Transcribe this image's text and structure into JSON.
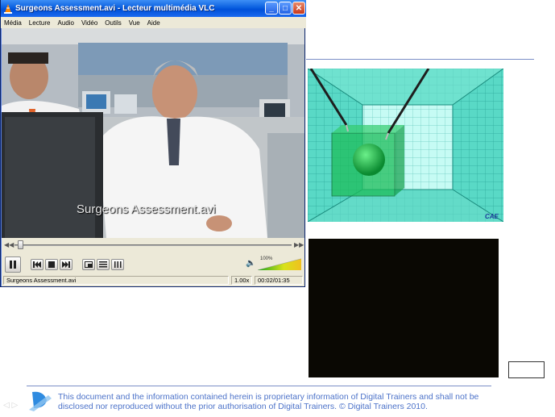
{
  "vlc": {
    "title": "Surgeons Assessment.avi - Lecteur multimédia VLC",
    "window_buttons": {
      "minimize": "_",
      "maximize": "□",
      "close": "✕"
    },
    "menu": [
      "Média",
      "Lecture",
      "Audio",
      "Vidéo",
      "Outils",
      "Vue",
      "Aide"
    ],
    "video_caption": "Surgeons Assessment.avi",
    "volume_percent": "100%",
    "volume_level": 1.0,
    "playback_progress": 0.02,
    "status": {
      "filename": "Surgeons Assessment.avi",
      "speed": "1.00x",
      "time": "00:02/01:35"
    },
    "icons": [
      "vlc-cone-icon",
      "skip-back-icon",
      "skip-forward-icon",
      "pause-icon",
      "previous-icon",
      "stop-icon",
      "next-icon",
      "fullscreen-icon",
      "playlist-icon",
      "equalizer-icon",
      "speaker-icon"
    ]
  },
  "sim": {
    "logo": "CAE",
    "colors": {
      "grid": "#49d7c1",
      "back_wall": "#b8f7ef",
      "cube": "#1dbd5a"
    }
  },
  "footer": {
    "text": "This document and the information contained herein is proprietary information of Digital Trainers and shall not be disclosed nor reproduced without the prior authorisation of Digital Trainers.  © Digital Trainers 2010.",
    "text_color": "#4d73c9",
    "nav": "◁ ▷"
  }
}
